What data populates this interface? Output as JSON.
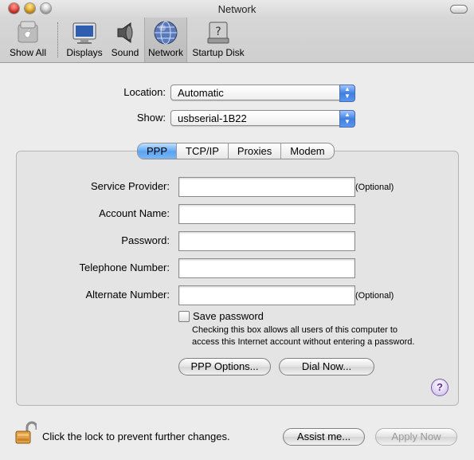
{
  "window": {
    "title": "Network"
  },
  "toolbar": {
    "items": [
      {
        "label": "Show All",
        "icon": "apple-logo-icon"
      },
      {
        "label": "Displays",
        "icon": "display-icon"
      },
      {
        "label": "Sound",
        "icon": "speaker-icon"
      },
      {
        "label": "Network",
        "icon": "globe-icon",
        "selected": true
      },
      {
        "label": "Startup Disk",
        "icon": "hard-disk-icon"
      }
    ]
  },
  "location": {
    "label": "Location:",
    "value": "Automatic"
  },
  "show": {
    "label": "Show:",
    "value": "usbserial-1B22"
  },
  "tabs": [
    {
      "label": "PPP",
      "active": true
    },
    {
      "label": "TCP/IP"
    },
    {
      "label": "Proxies"
    },
    {
      "label": "Modem"
    }
  ],
  "form": {
    "service_provider": {
      "label": "Service Provider:",
      "value": "",
      "note": "(Optional)"
    },
    "account_name": {
      "label": "Account Name:",
      "value": ""
    },
    "password": {
      "label": "Password:",
      "value": ""
    },
    "telephone_number": {
      "label": "Telephone Number:",
      "value": ""
    },
    "alternate_number": {
      "label": "Alternate Number:",
      "value": "",
      "note": "(Optional)"
    },
    "save_password": {
      "label": "Save password",
      "checked": false,
      "hint_line1": "Checking this box allows all users of this computer to",
      "hint_line2": "access this Internet account without entering a password."
    },
    "ppp_options_button": "PPP Options...",
    "dial_now_button": "Dial Now...",
    "help_glyph": "?"
  },
  "footer": {
    "lock_text": "Click the lock to prevent further changes.",
    "assist_button": "Assist me...",
    "apply_button": "Apply Now"
  },
  "colors": {
    "selected_tab": "#5aa3f2",
    "popup_arrows": "#3f7fe0",
    "help_accent": "#5b2f9e"
  }
}
